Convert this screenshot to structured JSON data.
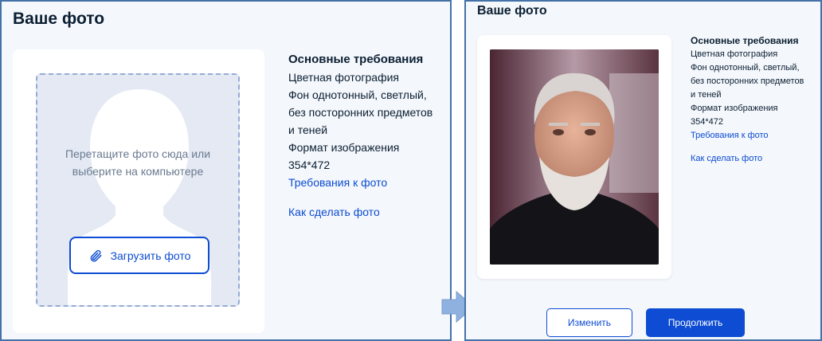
{
  "left": {
    "title": "Ваше фото",
    "dropzone": {
      "hint_line1": "Перетащите фото сюда или",
      "hint_line2": "выберите на компьютере",
      "upload_button": "Загрузить фото",
      "upload_icon": "paperclip-icon"
    },
    "requirements": {
      "title": "Основные требования",
      "lines": [
        "Цветная фотография",
        "Фон однотонный, светлый,",
        "без посторонних предметов",
        "и теней",
        "Формат изображения",
        "354*472"
      ],
      "link_requirements": "Требования к фото",
      "link_howto": "Как сделать фото"
    }
  },
  "right": {
    "title": "Ваше фото",
    "requirements": {
      "title": "Основные требования",
      "lines": [
        "Цветная фотография",
        "Фон однотонный, светлый,",
        "без посторонних предметов",
        "и теней",
        "Формат изображения",
        "354*472"
      ],
      "link_requirements": "Требования к фото",
      "link_howto": "Как сделать фото"
    },
    "buttons": {
      "change": "Изменить",
      "continue": "Продолжить"
    }
  },
  "colors": {
    "accent": "#0d4cd3",
    "panel_border": "#4472a8",
    "arrow": "#8fb1df"
  }
}
